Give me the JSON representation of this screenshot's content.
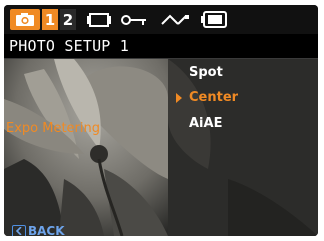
{
  "tabs": {
    "tab1_label": "1",
    "tab2_label": "2",
    "icons": [
      "camera-icon",
      "movie-icon",
      "playback-icon",
      "setup-icon",
      "wave-icon",
      "display-icon"
    ]
  },
  "header": {
    "title": "PHOTO SETUP 1"
  },
  "setting": {
    "label": "Expo Metering"
  },
  "menu": {
    "items": [
      {
        "label": "Spot",
        "selected": false
      },
      {
        "label": "Center",
        "selected": true
      },
      {
        "label": "AiAE",
        "selected": false
      }
    ]
  },
  "footer": {
    "back_label": "BACK"
  },
  "colors": {
    "accent": "#f08a24",
    "back": "#6da3ea",
    "background": "#0c0c0c"
  }
}
